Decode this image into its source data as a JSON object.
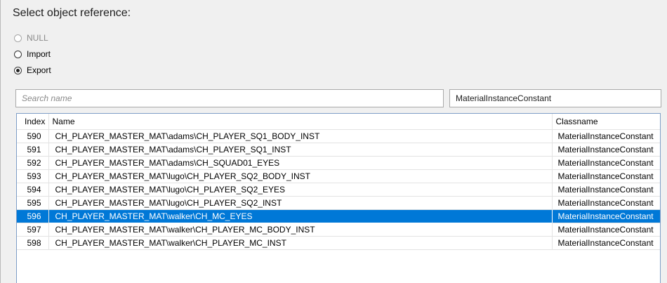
{
  "dialog": {
    "title": "Select object reference:"
  },
  "options": [
    {
      "label": "NULL",
      "checked": false,
      "disabled": true
    },
    {
      "label": "Import",
      "checked": false,
      "disabled": false
    },
    {
      "label": "Export",
      "checked": true,
      "disabled": false
    }
  ],
  "filters": {
    "search_placeholder": "Search name",
    "search_value": "",
    "class_value": "MaterialInstanceConstant"
  },
  "table": {
    "columns": [
      "Index",
      "Name",
      "Classname"
    ],
    "selected_index": "596",
    "rows": [
      {
        "index": "590",
        "name": "CH_PLAYER_MASTER_MAT\\adams\\CH_PLAYER_SQ1_BODY_INST",
        "classname": "MaterialInstanceConstant"
      },
      {
        "index": "591",
        "name": "CH_PLAYER_MASTER_MAT\\adams\\CH_PLAYER_SQ1_INST",
        "classname": "MaterialInstanceConstant"
      },
      {
        "index": "592",
        "name": "CH_PLAYER_MASTER_MAT\\adams\\CH_SQUAD01_EYES",
        "classname": "MaterialInstanceConstant"
      },
      {
        "index": "593",
        "name": "CH_PLAYER_MASTER_MAT\\lugo\\CH_PLAYER_SQ2_BODY_INST",
        "classname": "MaterialInstanceConstant"
      },
      {
        "index": "594",
        "name": "CH_PLAYER_MASTER_MAT\\lugo\\CH_PLAYER_SQ2_EYES",
        "classname": "MaterialInstanceConstant"
      },
      {
        "index": "595",
        "name": "CH_PLAYER_MASTER_MAT\\lugo\\CH_PLAYER_SQ2_INST",
        "classname": "MaterialInstanceConstant"
      },
      {
        "index": "596",
        "name": "CH_PLAYER_MASTER_MAT\\walker\\CH_MC_EYES",
        "classname": "MaterialInstanceConstant"
      },
      {
        "index": "597",
        "name": "CH_PLAYER_MASTER_MAT\\walker\\CH_PLAYER_MC_BODY_INST",
        "classname": "MaterialInstanceConstant"
      },
      {
        "index": "598",
        "name": "CH_PLAYER_MASTER_MAT\\walker\\CH_PLAYER_MC_INST",
        "classname": "MaterialInstanceConstant"
      }
    ]
  }
}
